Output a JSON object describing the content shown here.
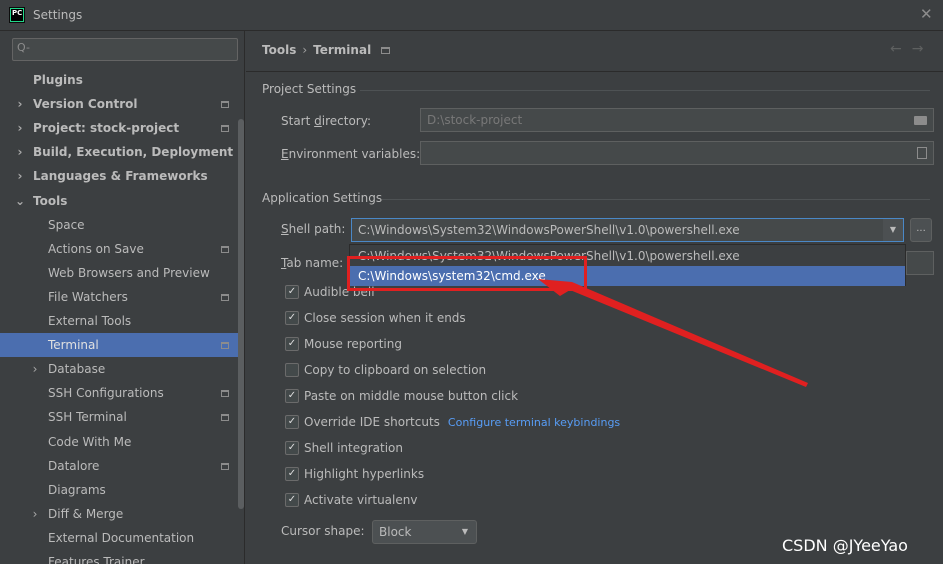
{
  "window": {
    "title": "Settings",
    "app_icon_text": "PC",
    "close_symbol": "✕"
  },
  "sidebar": {
    "search_placeholder": "Q-",
    "items": [
      {
        "label": "Plugins",
        "arrow": ""
      },
      {
        "label": "Version Control",
        "arrow": "›"
      },
      {
        "label": "Project: stock-project",
        "arrow": "›"
      },
      {
        "label": "Build, Execution, Deployment",
        "arrow": "›"
      },
      {
        "label": "Languages & Frameworks",
        "arrow": "›"
      },
      {
        "label": "Tools",
        "arrow": "⌄"
      },
      {
        "label": "Space",
        "arrow": ""
      },
      {
        "label": "Actions on Save",
        "arrow": ""
      },
      {
        "label": "Web Browsers and Preview",
        "arrow": ""
      },
      {
        "label": "File Watchers",
        "arrow": ""
      },
      {
        "label": "External Tools",
        "arrow": ""
      },
      {
        "label": "Terminal",
        "arrow": ""
      },
      {
        "label": "Database",
        "arrow": "›"
      },
      {
        "label": "SSH Configurations",
        "arrow": ""
      },
      {
        "label": "SSH Terminal",
        "arrow": ""
      },
      {
        "label": "Code With Me",
        "arrow": ""
      },
      {
        "label": "Datalore",
        "arrow": ""
      },
      {
        "label": "Diagrams",
        "arrow": ""
      },
      {
        "label": "Diff & Merge",
        "arrow": "›"
      },
      {
        "label": "External Documentation",
        "arrow": ""
      },
      {
        "label": "Features Trainer",
        "arrow": ""
      }
    ]
  },
  "header": {
    "breadcrumb_parent": "Tools",
    "breadcrumb_sep": "›",
    "breadcrumb_current": "Terminal",
    "nav_arrows": "←→"
  },
  "project_settings": {
    "title": "Project Settings",
    "start_dir_label_pre": "Start ",
    "start_dir_label_u": "d",
    "start_dir_label_post": "irectory:",
    "start_dir_value": "D:\\stock-project",
    "env_label_u": "E",
    "env_label_post": "nvironment variables:",
    "env_value": ""
  },
  "app_settings": {
    "title": "Application Settings",
    "shell_label_u": "S",
    "shell_label_post": "hell path:",
    "shell_value": "C:\\Windows\\System32\\WindowsPowerShell\\v1.0\\powershell.exe",
    "browse_label": "...",
    "dropdown_options": [
      "C:\\Windows\\System32\\WindowsPowerShell\\v1.0\\powershell.exe",
      "C:\\Windows\\system32\\cmd.exe"
    ],
    "tab_label_u": "T",
    "tab_label_post": "ab name:"
  },
  "checkboxes": [
    {
      "label": "Audible bell",
      "checked": true
    },
    {
      "label": "Close session when it ends",
      "checked": true
    },
    {
      "label": "Mouse reporting",
      "checked": true
    },
    {
      "label": "Copy to clipboard on selection",
      "checked": false
    },
    {
      "label": "Paste on middle mouse button click",
      "checked": true
    },
    {
      "label": "Override IDE shortcuts",
      "checked": true,
      "link": "Configure terminal keybindings"
    },
    {
      "label": "Shell integration",
      "checked": true
    },
    {
      "label": "Highlight hyperlinks",
      "checked": true
    },
    {
      "label": "Activate virtualenv",
      "checked": true
    }
  ],
  "cursor": {
    "label": "Cursor shape:",
    "value": "Block"
  },
  "watermark": "CSDN @JYeeYao",
  "colors": {
    "accent": "#4b6eaf",
    "annotation_red": "#e02020",
    "link": "#589df6"
  }
}
